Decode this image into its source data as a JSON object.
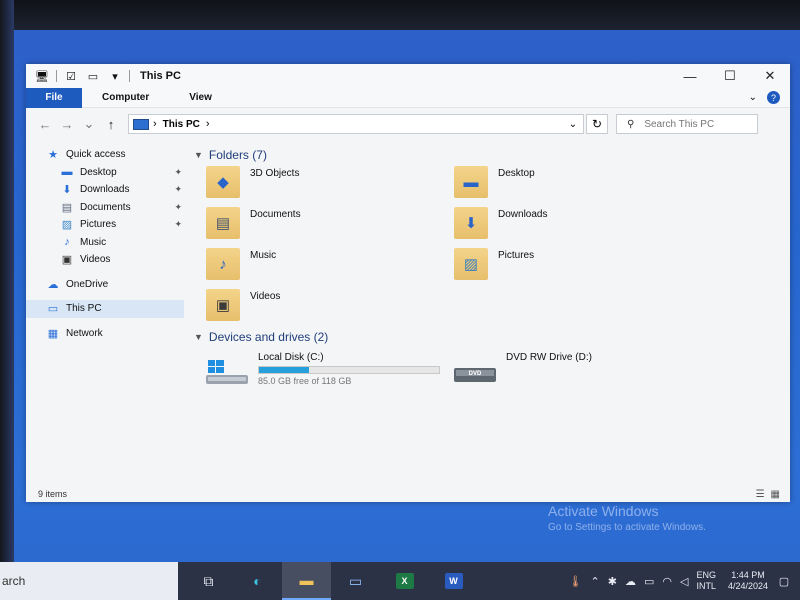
{
  "window": {
    "title": "This PC",
    "controls": {
      "minimize": "—",
      "maximize": "☐",
      "close": "✕"
    }
  },
  "ribbon": {
    "tabs": [
      "File",
      "Computer",
      "View"
    ],
    "chevron": "⌄",
    "help": "?"
  },
  "address": {
    "back": "←",
    "forward": "→",
    "recent": "⌄",
    "up": "↑",
    "crumb_sep": "›",
    "crumb": "This PC",
    "crumb_end": "›",
    "dropdown": "⌄",
    "refresh": "↻",
    "search_icon": "⚲",
    "search_placeholder": "Search This PC"
  },
  "navpane": {
    "quick_access": "Quick access",
    "quick_items": [
      {
        "label": "Desktop",
        "icon": "desktop-icon",
        "pinned": true
      },
      {
        "label": "Downloads",
        "icon": "download-icon",
        "pinned": true
      },
      {
        "label": "Documents",
        "icon": "document-icon",
        "pinned": true
      },
      {
        "label": "Pictures",
        "icon": "picture-icon",
        "pinned": true
      },
      {
        "label": "Music",
        "icon": "music-icon",
        "pinned": false
      },
      {
        "label": "Videos",
        "icon": "video-icon",
        "pinned": false
      }
    ],
    "onedrive": "OneDrive",
    "this_pc": "This PC",
    "network": "Network",
    "pin_glyph": "📌"
  },
  "content": {
    "folders_header": "Folders (7)",
    "folders": [
      {
        "name": "3D Objects",
        "icon": "3d-objects-folder-icon"
      },
      {
        "name": "Desktop",
        "icon": "desktop-folder-icon"
      },
      {
        "name": "Documents",
        "icon": "documents-folder-icon"
      },
      {
        "name": "Downloads",
        "icon": "downloads-folder-icon"
      },
      {
        "name": "Music",
        "icon": "music-folder-icon"
      },
      {
        "name": "Pictures",
        "icon": "pictures-folder-icon"
      },
      {
        "name": "Videos",
        "icon": "videos-folder-icon"
      }
    ],
    "drives_header": "Devices and drives (2)",
    "drives": [
      {
        "name": "Local Disk (C:)",
        "free": "85.0 GB free of 118 GB",
        "used_fraction": 0.28,
        "icon": "windows-drive-icon"
      },
      {
        "name": "DVD RW Drive (D:)",
        "icon": "dvd-drive-icon",
        "label": "DVD"
      }
    ]
  },
  "status": {
    "items": "9 items"
  },
  "watermark": {
    "line1": "Activate Windows",
    "line2": "Go to Settings to activate Windows."
  },
  "taskbar": {
    "search_text": "arch",
    "lang_top": "ENG",
    "lang_bottom": "INTL",
    "time": "1:44 PM",
    "date": "4/24/2024",
    "excel_badge": "X",
    "word_badge": "W"
  },
  "colors": {
    "accent": "#1e5bbf",
    "desktop": "#2b67cc",
    "taskbar": "#2c3245"
  }
}
